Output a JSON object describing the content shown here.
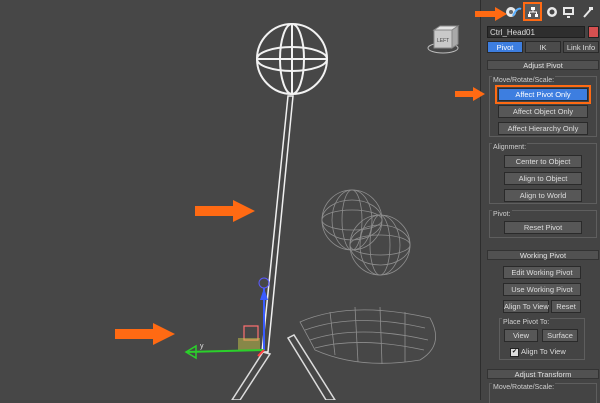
{
  "command_panel": {
    "tabs": [
      {
        "icon": "create-icon"
      },
      {
        "icon": "modify-icon"
      },
      {
        "icon": "hierarchy-icon",
        "active": true
      },
      {
        "icon": "motion-icon"
      },
      {
        "icon": "display-icon"
      },
      {
        "icon": "utilities-icon"
      }
    ],
    "object_name": "Ctrl_Head01",
    "object_color": "#d65050",
    "subtabs": [
      "Pivot",
      "IK",
      "Link Info"
    ],
    "active_subtab": "Pivot"
  },
  "adjust_pivot": {
    "title": "Adjust Pivot",
    "move_group_label": "Move/Rotate/Scale:",
    "buttons": [
      "Affect Pivot Only",
      "Affect Object Only",
      "Affect Hierarchy Only"
    ],
    "active_button": "Affect Pivot Only",
    "alignment_label": "Alignment:",
    "alignment_buttons": [
      "Center to Object",
      "Align to Object",
      "Align to World"
    ],
    "pivot_label": "Pivot:",
    "reset_pivot": "Reset Pivot"
  },
  "working_pivot": {
    "title": "Working Pivot",
    "edit": "Edit Working Pivot",
    "use": "Use Working Pivot",
    "align_to_view": "Align To View",
    "reset": "Reset",
    "place_label": "Place Pivot To:",
    "view": "View",
    "surface": "Surface",
    "align_checkbox": "Align To View",
    "align_checked": true
  },
  "adjust_transform": {
    "title": "Adjust Transform",
    "move_group_label": "Move/Rotate/Scale:"
  },
  "viewcube": {
    "label": "LEFT"
  },
  "gizmo": {
    "axis_label": "y"
  },
  "accent_color": "#ff6a13",
  "active_blue": "#3d7ee0"
}
